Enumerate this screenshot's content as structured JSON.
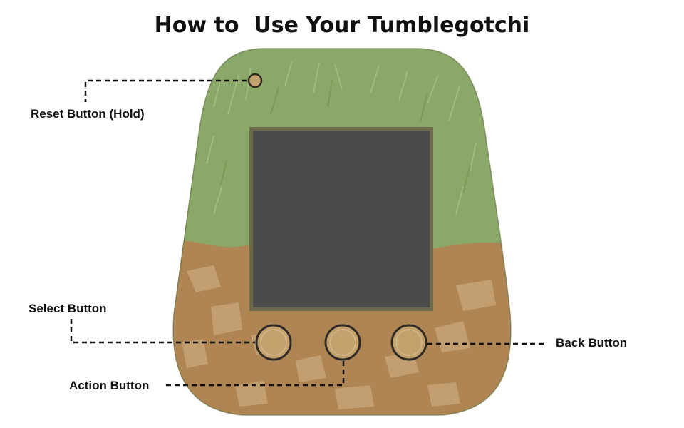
{
  "title": "How to  Use Your Tumblegotchi",
  "labels": {
    "reset": "Reset Button (Hold)",
    "select": "Select Button",
    "action": "Action Button",
    "back": "Back Button"
  },
  "colors": {
    "grass": "#8aa867",
    "grass_dark": "#6f9450",
    "dirt": "#b08554",
    "dirt_light": "#c9a77a",
    "screen": "#4a4a4a",
    "screen_border": "#6b6a4a",
    "button_fill": "#c4a26e",
    "button_ring": "#2e2a24",
    "leader": "#111111"
  }
}
